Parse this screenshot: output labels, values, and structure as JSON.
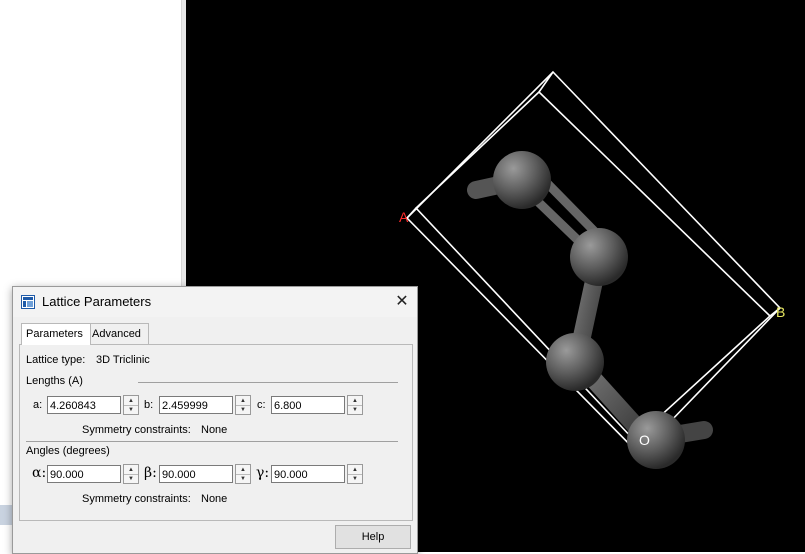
{
  "viewport": {
    "axis_labels": {
      "a": "A",
      "b": "B",
      "origin": "O"
    }
  },
  "dialog": {
    "title": "Lattice Parameters",
    "close_label": "✕",
    "tabs": [
      {
        "label": "Parameters",
        "active": true
      },
      {
        "label": "Advanced",
        "active": false
      }
    ],
    "lattice_type_label": "Lattice type:",
    "lattice_type_value": "3D Triclinic",
    "lengths_heading": "Lengths (A)",
    "lengths": [
      {
        "label": "a:",
        "value": "4.260843"
      },
      {
        "label": "b:",
        "value": "2.459999"
      },
      {
        "label": "c:",
        "value": "6.800"
      }
    ],
    "lengths_constraints_label": "Symmetry constraints:",
    "lengths_constraints_value": "None",
    "angles_heading": "Angles (degrees)",
    "angles": [
      {
        "label": "α:",
        "value": "90.000"
      },
      {
        "label": "β:",
        "value": "90.000"
      },
      {
        "label": "γ:",
        "value": "90.000"
      }
    ],
    "angles_constraints_label": "Symmetry constraints:",
    "angles_constraints_value": "None",
    "help_label": "Help"
  },
  "colors": {
    "axis_a": "#ff2a2a",
    "axis_b": "#e8e860",
    "axis_o": "#ffffff",
    "atom": "#5e5e5e",
    "cell": "#ffffff"
  }
}
